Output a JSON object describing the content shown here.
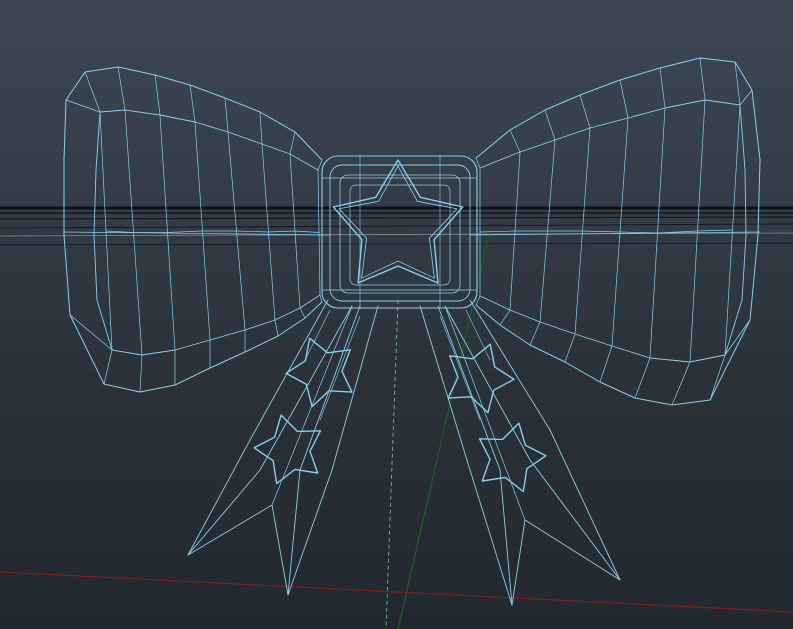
{
  "viewport": {
    "view": "perspective",
    "object": "bow-mesh",
    "display_mode": "wireframe",
    "colors": {
      "background_top": "#3d4754",
      "background_bottom": "#22282f",
      "wireframe": "#8ecde8",
      "grid": "#0d1014",
      "grid_light": "#c9d0d6",
      "axis_x": "#7a1d1d",
      "axis_z": "#1f5b2a"
    }
  }
}
